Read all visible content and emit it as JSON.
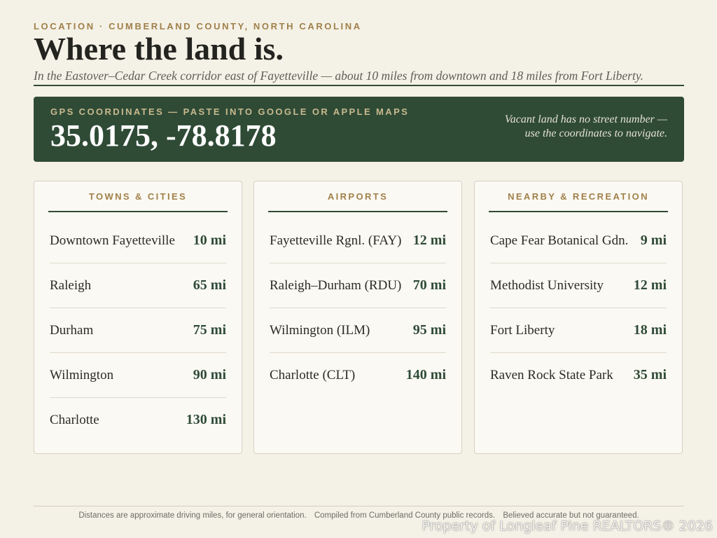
{
  "header": {
    "eyebrow": "LOCATION · CUMBERLAND COUNTY, NORTH CAROLINA",
    "title": "Where the land is.",
    "subtitle": "In the Eastover–Cedar Creek corridor east of Fayetteville — about 10 miles from downtown and 18 miles from Fort Liberty."
  },
  "gps": {
    "label": "GPS COORDINATES — PASTE INTO GOOGLE OR APPLE MAPS",
    "coordinates": "35.0175, -78.8178",
    "note_line1": "Vacant land has no street number —",
    "note_line2": "use the coordinates to navigate."
  },
  "cards": [
    {
      "title": "TOWNS & CITIES",
      "rows": [
        {
          "name": "Downtown Fayetteville",
          "distance": "10 mi"
        },
        {
          "name": "Raleigh",
          "distance": "65 mi"
        },
        {
          "name": "Durham",
          "distance": "75 mi"
        },
        {
          "name": "Wilmington",
          "distance": "90 mi"
        },
        {
          "name": "Charlotte",
          "distance": "130 mi"
        }
      ]
    },
    {
      "title": "AIRPORTS",
      "rows": [
        {
          "name": "Fayetteville Rgnl. (FAY)",
          "distance": "12 mi"
        },
        {
          "name": "Raleigh–Durham (RDU)",
          "distance": "70 mi"
        },
        {
          "name": "Wilmington (ILM)",
          "distance": "95 mi"
        },
        {
          "name": "Charlotte (CLT)",
          "distance": "140 mi"
        }
      ]
    },
    {
      "title": "NEARBY & RECREATION",
      "rows": [
        {
          "name": "Cape Fear Botanical Gdn.",
          "distance": "9 mi"
        },
        {
          "name": "Methodist University",
          "distance": "12 mi"
        },
        {
          "name": "Fort Liberty",
          "distance": "18 mi"
        },
        {
          "name": "Raven Rock State Park",
          "distance": "35 mi"
        }
      ]
    }
  ],
  "footer": {
    "note1": "Distances are approximate driving miles, for general orientation.",
    "note2": "Compiled from Cumberland County public records.",
    "note3": "Believed accurate but not guaranteed."
  },
  "watermark": "Property of Longleaf Pine REALTORS® 2026",
  "colors": {
    "background": "#f4f1e6",
    "accent_green": "#2f4b36",
    "accent_gold": "#a0804a"
  }
}
